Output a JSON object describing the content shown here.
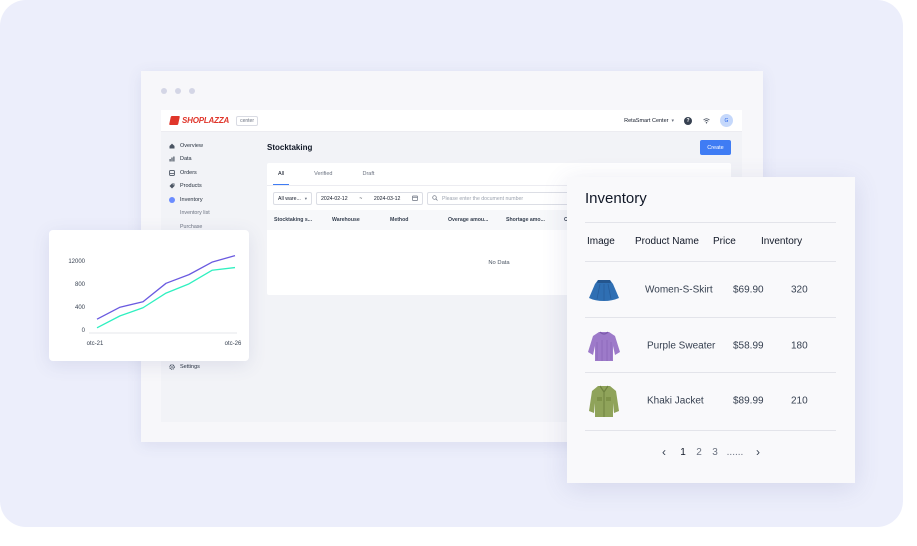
{
  "app": {
    "logo_text": "SHOPLAZZA",
    "logo_badge": "center",
    "store_name": "RetaSmart Center",
    "avatar_initial": "G"
  },
  "sidebar": {
    "items": [
      {
        "label": "Overview",
        "icon": "home-icon"
      },
      {
        "label": "Data",
        "icon": "bar-chart-icon"
      },
      {
        "label": "Orders",
        "icon": "orders-icon"
      },
      {
        "label": "Products",
        "icon": "tag-icon"
      },
      {
        "label": "Inventory",
        "icon": "inventory-icon"
      }
    ],
    "subitems": [
      "Inventory list",
      "Purchase"
    ],
    "settings_label": "Settings"
  },
  "stocktaking": {
    "title": "Stocktaking",
    "create_label": "Create",
    "tabs": [
      "All",
      "Verified",
      "Draft"
    ],
    "warehouse_filter": "All ware...",
    "date_start": "2024-02-12",
    "date_separator": "~",
    "date_end": "2024-03-12",
    "search_placeholder": "Please enter the document number",
    "columns": [
      "Stocktaking s...",
      "Warehouse",
      "Method",
      "Overage amou...",
      "Shortage amo...",
      "C"
    ],
    "empty_text": "No Data"
  },
  "chart_data": {
    "type": "line",
    "x": [
      "otc-21",
      "",
      "",
      "",
      "",
      "",
      "otc-26"
    ],
    "series": [
      {
        "values": [
          200,
          420,
          520,
          860,
          1020,
          1250,
          1370
        ],
        "color": "#6a5ae0"
      },
      {
        "values": [
          40,
          260,
          410,
          680,
          850,
          1100,
          1150
        ],
        "color": "#2ff0c0"
      }
    ],
    "y_ticks": [
      0,
      400,
      800,
      12000
    ],
    "xlabel_ticks": [
      "otc-21",
      "otc-26"
    ],
    "ylim": [
      0,
      1400
    ]
  },
  "inventory": {
    "title": "Inventory",
    "headers": [
      "Image",
      "Product Name",
      "Price",
      "Inventory"
    ],
    "rows": [
      {
        "name": "Women-S-Skirt",
        "price": "$69.90",
        "stock": "320",
        "image": "blue-skirt"
      },
      {
        "name": "Purple Sweater",
        "price": "$58.99",
        "stock": "180",
        "image": "purple-sweater"
      },
      {
        "name": "Khaki Jacket",
        "price": "$89.99",
        "stock": "210",
        "image": "khaki-jacket"
      }
    ],
    "pagination": {
      "prev": "‹",
      "pages": [
        "1",
        "2",
        "3"
      ],
      "ellipsis": "......",
      "next": "›",
      "current": "1"
    }
  }
}
